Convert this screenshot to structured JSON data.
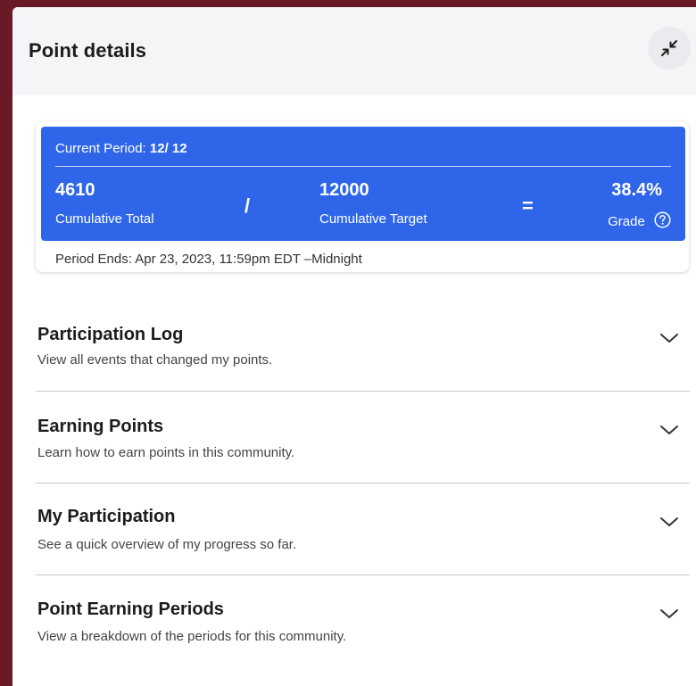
{
  "header": {
    "title": "Point details",
    "collapse_icon": "collapse-arrows-icon"
  },
  "period_card": {
    "period_prefix": "Current Period:",
    "period_value": "12/ 12",
    "cumulative_total_value": "4610",
    "cumulative_total_label": "Cumulative Total",
    "divide_op": "/",
    "cumulative_target_value": "12000",
    "cumulative_target_label": "Cumulative Target",
    "equals_op": "=",
    "grade_value": "38.4%",
    "grade_label": "Grade",
    "grade_help_icon": "question-circle-icon",
    "grade_fraction": 0.384,
    "period_ends": "Period Ends: Apr 23, 2023, 11:59pm EDT –Midnight",
    "accent_color": "#2f66e9"
  },
  "sections": [
    {
      "title": "Participation Log",
      "subtitle": "View all events that changed my points.",
      "icon": "chevron-down-icon"
    },
    {
      "title": "Earning Points",
      "subtitle": "Learn how to earn points in this community.",
      "icon": "chevron-down-icon"
    },
    {
      "title": "My Participation",
      "subtitle": "See a quick overview of my progress so far.",
      "icon": "chevron-down-icon"
    },
    {
      "title": "Point Earning Periods",
      "subtitle": "View a breakdown of the periods for this community.",
      "icon": "chevron-down-icon"
    }
  ]
}
